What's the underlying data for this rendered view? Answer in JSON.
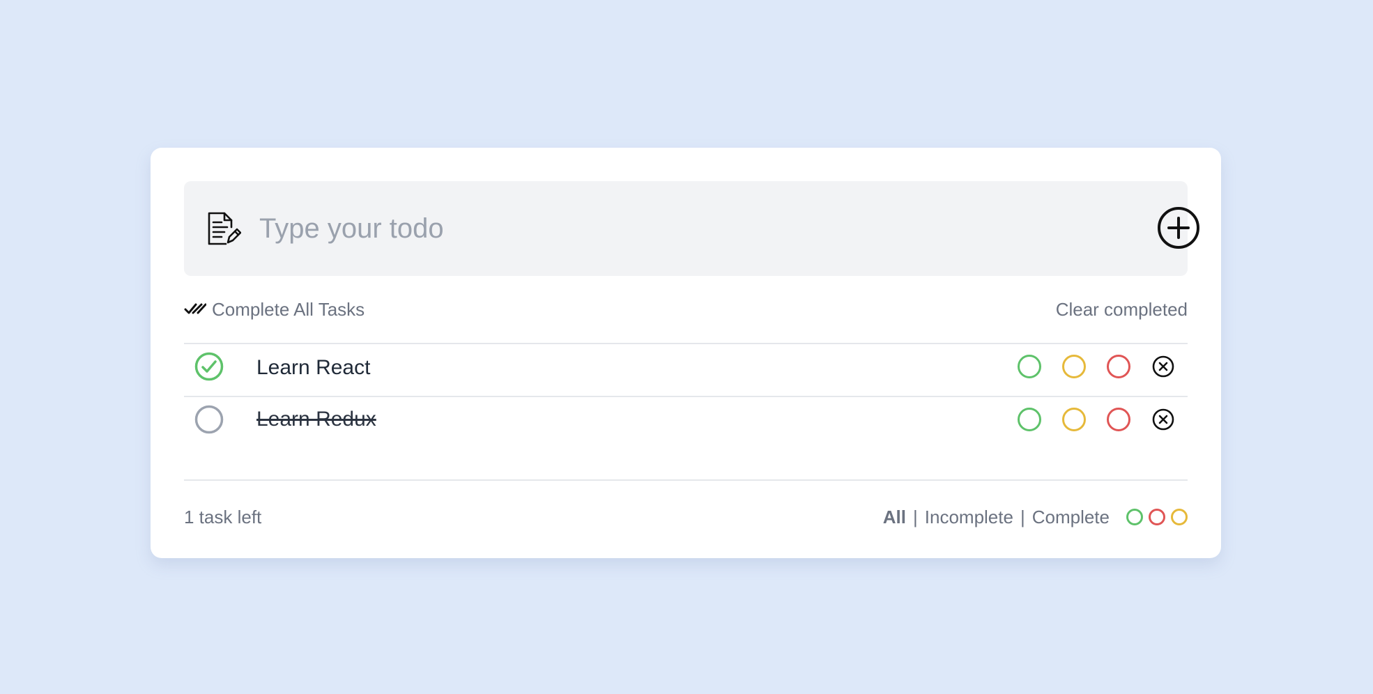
{
  "input": {
    "placeholder": "Type your todo",
    "value": "",
    "icon": "note-edit-icon",
    "add_icon": "plus-circle-icon"
  },
  "toolbar": {
    "complete_all_label": "Complete All Tasks",
    "complete_all_icon": "double-check-icon",
    "clear_completed_label": "Clear completed"
  },
  "todos": [
    {
      "text": "Learn React",
      "checked": true,
      "struck_through": false
    },
    {
      "text": "Learn Redux",
      "checked": false,
      "struck_through": true
    }
  ],
  "row_actions": {
    "color_options": [
      "green",
      "yellow",
      "red"
    ],
    "delete_icon": "close-circle-icon"
  },
  "footer": {
    "tasks_left": "1 task left",
    "filters": [
      {
        "label": "All",
        "active": true
      },
      {
        "label": "Incomplete",
        "active": false
      },
      {
        "label": "Complete",
        "active": false
      }
    ],
    "separator": "|",
    "color_filters": [
      "green",
      "red",
      "yellow"
    ]
  },
  "colors": {
    "background": "#dde8f9",
    "card": "#ffffff",
    "input_bg": "#f2f3f5",
    "green": "#5ec26a",
    "yellow": "#e6b93a",
    "red": "#e05555",
    "muted_text": "#6b7280",
    "unchecked": "#9ca3af"
  }
}
